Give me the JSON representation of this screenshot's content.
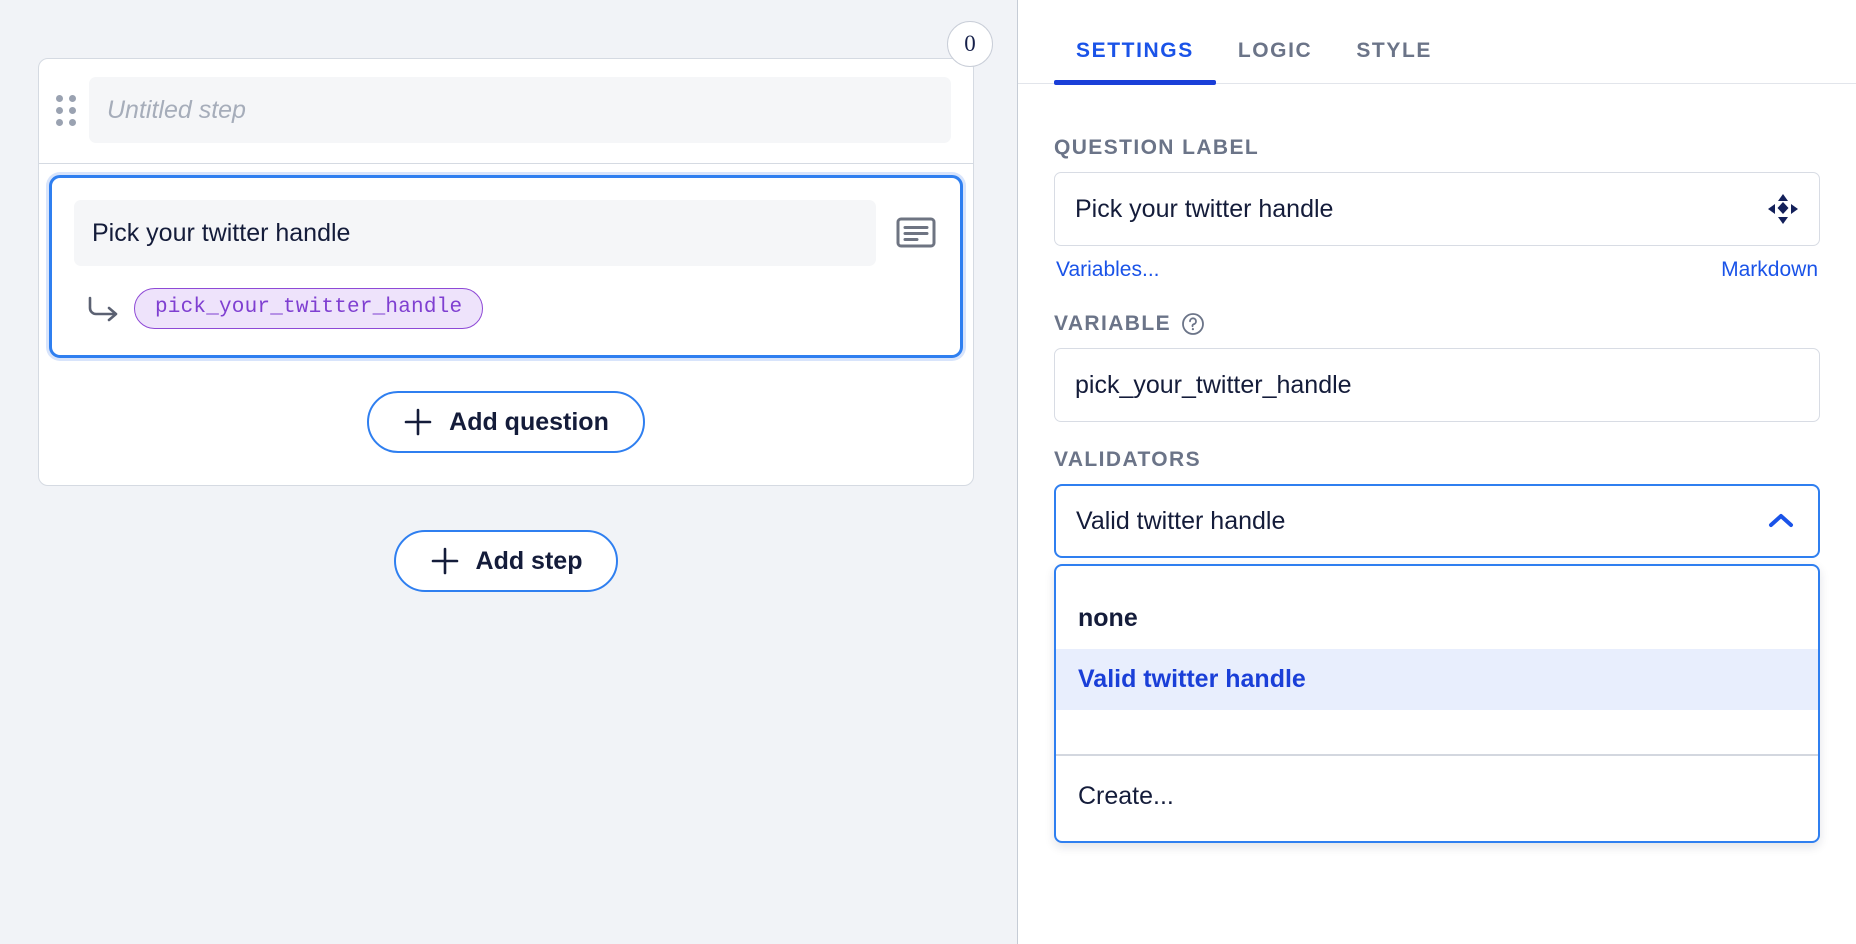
{
  "canvas": {
    "step": {
      "badge": "0",
      "title_placeholder": "Untitled step",
      "drag_handle_name": "drag-handle"
    },
    "question": {
      "label": "Pick your twitter handle",
      "variable_chip": "pick_your_twitter_handle",
      "type_icon": "long-text-icon"
    },
    "add_question_label": "Add question",
    "add_step_label": "Add step"
  },
  "panel": {
    "tabs": [
      {
        "label": "SETTINGS",
        "active": true
      },
      {
        "label": "LOGIC",
        "active": false
      },
      {
        "label": "STYLE",
        "active": false
      }
    ],
    "question_label": {
      "section_label": "QUESTION LABEL",
      "value": "Pick your twitter handle",
      "move_icon": "move-arrows-icon"
    },
    "links": {
      "variables": "Variables...",
      "markdown": "Markdown"
    },
    "variable": {
      "section_label": "VARIABLE",
      "help_icon": "help-circle-icon",
      "value": "pick_your_twitter_handle"
    },
    "validators": {
      "section_label": "VALIDATORS",
      "selected": "Valid twitter handle",
      "chevron_icon": "chevron-up-icon",
      "options": [
        {
          "label": "none",
          "highlighted": false
        },
        {
          "label": "Valid twitter handle",
          "highlighted": true
        }
      ],
      "create_label": "Create..."
    }
  },
  "colors": {
    "accent_blue": "#2f7ff0",
    "link_blue": "#1a53e8",
    "active_tab_blue": "#1a3fd8",
    "chip_purple": "#7f3fd1",
    "chip_purple_bg": "#eee3fb",
    "canvas_bg": "#f1f3f7",
    "text_navy": "#141c3a",
    "muted_gray": "#6b7488"
  }
}
